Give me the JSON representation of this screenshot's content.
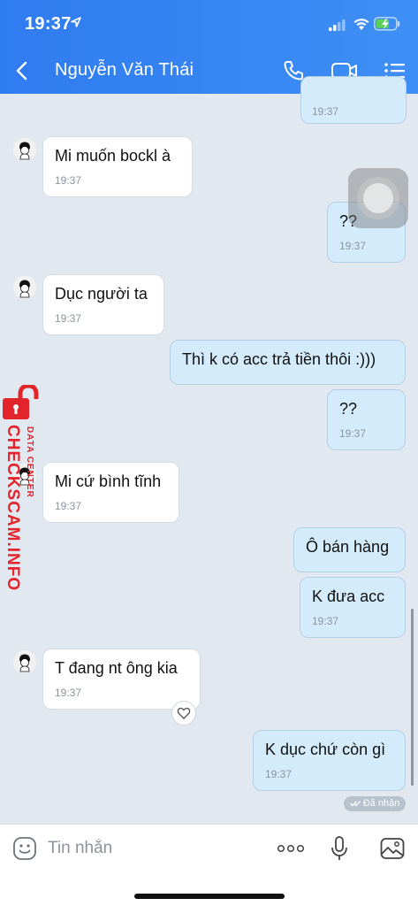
{
  "status_bar": {
    "time": "19:37"
  },
  "header": {
    "contact_name": "Nguyễn Văn Thái",
    "icons": [
      "back-icon",
      "phone-icon",
      "video-call-icon",
      "menu-list-icon"
    ]
  },
  "messages": [
    {
      "side": "out",
      "text": "",
      "time": "19:37"
    },
    {
      "side": "in",
      "text": "Mi muốn bockl à",
      "time": "19:37"
    },
    {
      "side": "out",
      "text": "??",
      "time": "19:37"
    },
    {
      "side": "in",
      "text": "Dục người ta",
      "time": "19:37"
    },
    {
      "side": "out",
      "text": "Thì k có acc trả tiền thôi :)))",
      "time": ""
    },
    {
      "side": "out",
      "text": "??",
      "time": "19:37"
    },
    {
      "side": "in",
      "text": "Mi cứ bình tĩnh",
      "time": "19:37"
    },
    {
      "side": "out",
      "text": "Ô bán hàng",
      "time": ""
    },
    {
      "side": "out",
      "text": "K đưa acc",
      "time": "19:37"
    },
    {
      "side": "in",
      "text": "T đang nt ông kia",
      "time": "19:37"
    },
    {
      "side": "out",
      "text": "K dục chứ còn gì",
      "time": "19:37"
    }
  ],
  "received_status": "Đã nhận",
  "watermark": {
    "main": "CHECKSCAM.INFO",
    "sub": "DATA CENTER"
  },
  "input_bar": {
    "placeholder": "Tin nhắn",
    "value": ""
  },
  "colors": {
    "header_bg": "#3087f2",
    "chat_bg": "#e2e8f0",
    "incoming_bubble": "#ffffff",
    "outgoing_bubble": "#d4ebfb",
    "watermark": "#e3242b"
  }
}
